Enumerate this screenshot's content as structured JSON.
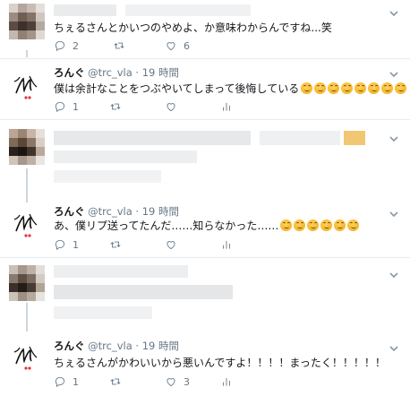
{
  "user": {
    "display_name": "ろんぐ",
    "handle": "@trc_vla"
  },
  "tweets": [
    {
      "id": "t1",
      "author_hidden": true,
      "text": "ちぇるさんとかいつのやめよ、か意味わからんですね...笑",
      "reply_count": "2",
      "retweet_count": "",
      "like_count": "6"
    },
    {
      "id": "t2",
      "time": "19 時間",
      "text": "僕は余計なことをつぶやいてしまって後悔している",
      "emoji_count": 8,
      "reply_count": "1",
      "retweet_count": "",
      "like_count": ""
    },
    {
      "id": "t3",
      "author_hidden": true,
      "text_hidden": true
    },
    {
      "id": "t4",
      "time": "19 時間",
      "text": "あ、僕リプ送ってたんだ……知らなかった……",
      "emoji_count": 6,
      "reply_count": "1",
      "retweet_count": "",
      "like_count": ""
    },
    {
      "id": "t5",
      "author_hidden": true,
      "text_hidden": true
    },
    {
      "id": "t6",
      "time": "19 時間",
      "text": "ちぇるさんがかわいいから悪いんですよ！！！！まったく！！！！！",
      "reply_count": "1",
      "retweet_count": "",
      "like_count": "3"
    }
  ],
  "icons": {
    "reply": "reply-icon",
    "retweet": "retweet-icon",
    "like": "heart-icon",
    "analytics": "analytics-icon",
    "more": "chevron-down-icon"
  },
  "colors": {
    "secondary_text": "#657786",
    "thread_line": "#ccd6dd",
    "divider": "#e6ecf0"
  }
}
